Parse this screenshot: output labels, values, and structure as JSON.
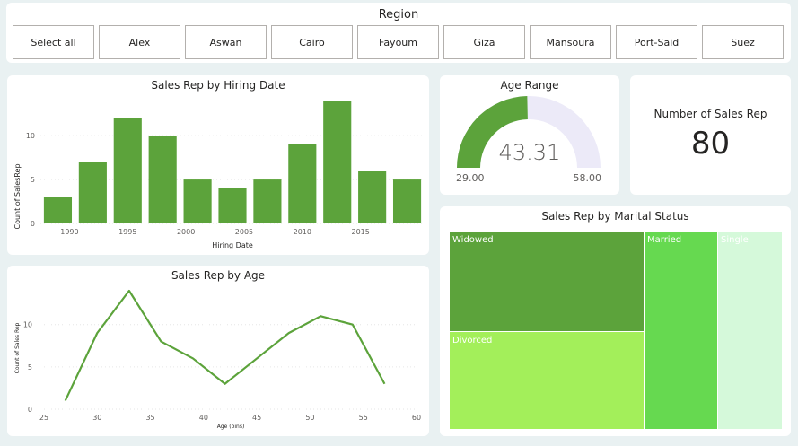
{
  "region": {
    "title": "Region",
    "options": [
      "Select all",
      "Alex",
      "Aswan",
      "Cairo",
      "Fayoum",
      "Giza",
      "Mansoura",
      "Port-Said",
      "Suez"
    ]
  },
  "hiring": {
    "title": "Sales Rep by Hiring Date",
    "chart_data": {
      "type": "bar",
      "title": "Sales Rep by Hiring Date",
      "xlabel": "Hiring Date",
      "ylabel": "Count of SalesRep",
      "x": [
        1989,
        1992,
        1995,
        1998,
        2001,
        2004,
        2007,
        2010,
        2013,
        2016,
        2019
      ],
      "values": [
        3,
        7,
        12,
        10,
        5,
        4,
        5,
        9,
        14,
        6,
        5
      ],
      "xticks": [
        "1990",
        "1995",
        "2000",
        "2005",
        "2010",
        "2015"
      ],
      "yticks": [
        "0",
        "5",
        "10"
      ],
      "ylim": [
        0,
        14
      ],
      "color": "#5ca33b"
    }
  },
  "age": {
    "title": "Sales Rep by Age",
    "chart_data": {
      "type": "line",
      "title": "Sales Rep by Age",
      "xlabel": "Age (bins)",
      "ylabel": "Count of Sales Rep",
      "x": [
        27,
        30,
        33,
        36,
        39,
        42,
        45,
        48,
        51,
        54,
        57
      ],
      "values": [
        1,
        9,
        14,
        8,
        6,
        3,
        6,
        9,
        11,
        10,
        3
      ],
      "xticks": [
        "25",
        "30",
        "35",
        "40",
        "45",
        "50",
        "55",
        "60"
      ],
      "yticks": [
        "0",
        "5",
        "10"
      ],
      "xlim": [
        25,
        60
      ],
      "ylim": [
        0,
        14
      ],
      "color": "#5ca33b"
    }
  },
  "gauge": {
    "title": "Age Range",
    "value": "43.31",
    "min": "29.00",
    "max": "58.00",
    "numeric_value": 43.31,
    "numeric_min": 29,
    "numeric_max": 58,
    "fill_color": "#5ca33b",
    "track_color": "#eceaf8"
  },
  "kpi": {
    "label": "Number of Sales Rep",
    "value": "80"
  },
  "marital": {
    "title": "Sales Rep by Marital Status",
    "chart_data": {
      "type": "treemap",
      "categories": [
        "Widowed",
        "Divorced",
        "Married",
        "Single"
      ],
      "colors": [
        "#5ca33b",
        "#a3ef5a",
        "#66d950",
        "#d5f9da"
      ]
    }
  }
}
